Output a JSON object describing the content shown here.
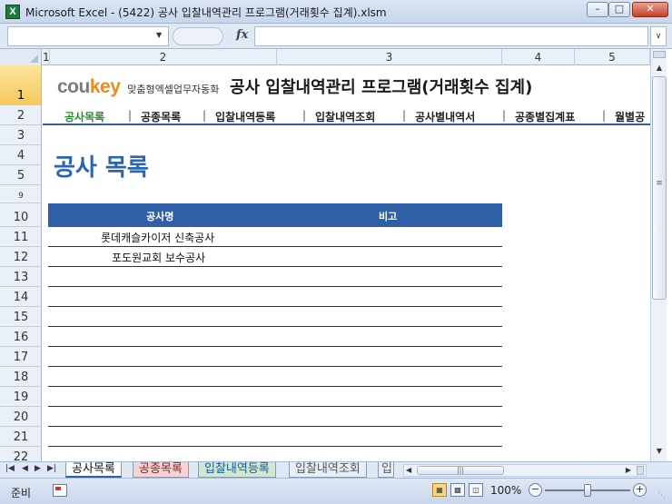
{
  "window": {
    "title": "Microsoft Excel - (5422) 공사 입찰내역관리 프로그램(거래횟수 집계).xlsm",
    "icon": "excel-icon"
  },
  "formula_bar": {
    "name_box": "",
    "fx_label": "fx",
    "formula": ""
  },
  "columns": [
    "1",
    "2",
    "3",
    "4",
    "5"
  ],
  "rows": [
    "1",
    "2",
    "3",
    "4",
    "5",
    "9",
    "10",
    "11",
    "12",
    "13",
    "14",
    "15",
    "16",
    "17",
    "18",
    "19",
    "20",
    "21",
    "22"
  ],
  "sheet": {
    "brand_logo_main": "cou",
    "brand_logo_accent": "key",
    "brand_tagline": "맞춤형엑셀업무자동화",
    "app_heading": "공사 입찰내역관리 프로그램(거래횟수 집계)",
    "nav": [
      "공사목록",
      "공종목록",
      "입찰내역등록",
      "입찰내역조회",
      "공사별내역서",
      "공종별집계표",
      "월별공"
    ],
    "nav_current": "공사목록",
    "page_title": "공사 목록",
    "table_headers": {
      "name": "공사명",
      "note": "비고"
    },
    "table_rows": [
      {
        "name": "롯데캐슬카이저 신축공사",
        "note": ""
      },
      {
        "name": "포도원교회 보수공사",
        "note": ""
      },
      {
        "name": "",
        "note": ""
      },
      {
        "name": "",
        "note": ""
      },
      {
        "name": "",
        "note": ""
      },
      {
        "name": "",
        "note": ""
      },
      {
        "name": "",
        "note": ""
      },
      {
        "name": "",
        "note": ""
      },
      {
        "name": "",
        "note": ""
      },
      {
        "name": "",
        "note": ""
      },
      {
        "name": "",
        "note": ""
      }
    ]
  },
  "tabs": [
    "공사목록",
    "공종목록",
    "입찰내역등록",
    "입찰내역조회",
    "입"
  ],
  "status": {
    "ready": "준비",
    "zoom": "100%"
  },
  "colors": {
    "header_blue": "#2e5fa7",
    "title_blue": "#2a66ae",
    "nav_current_green": "#2a8a2a",
    "logo_orange": "#f08a1d"
  }
}
